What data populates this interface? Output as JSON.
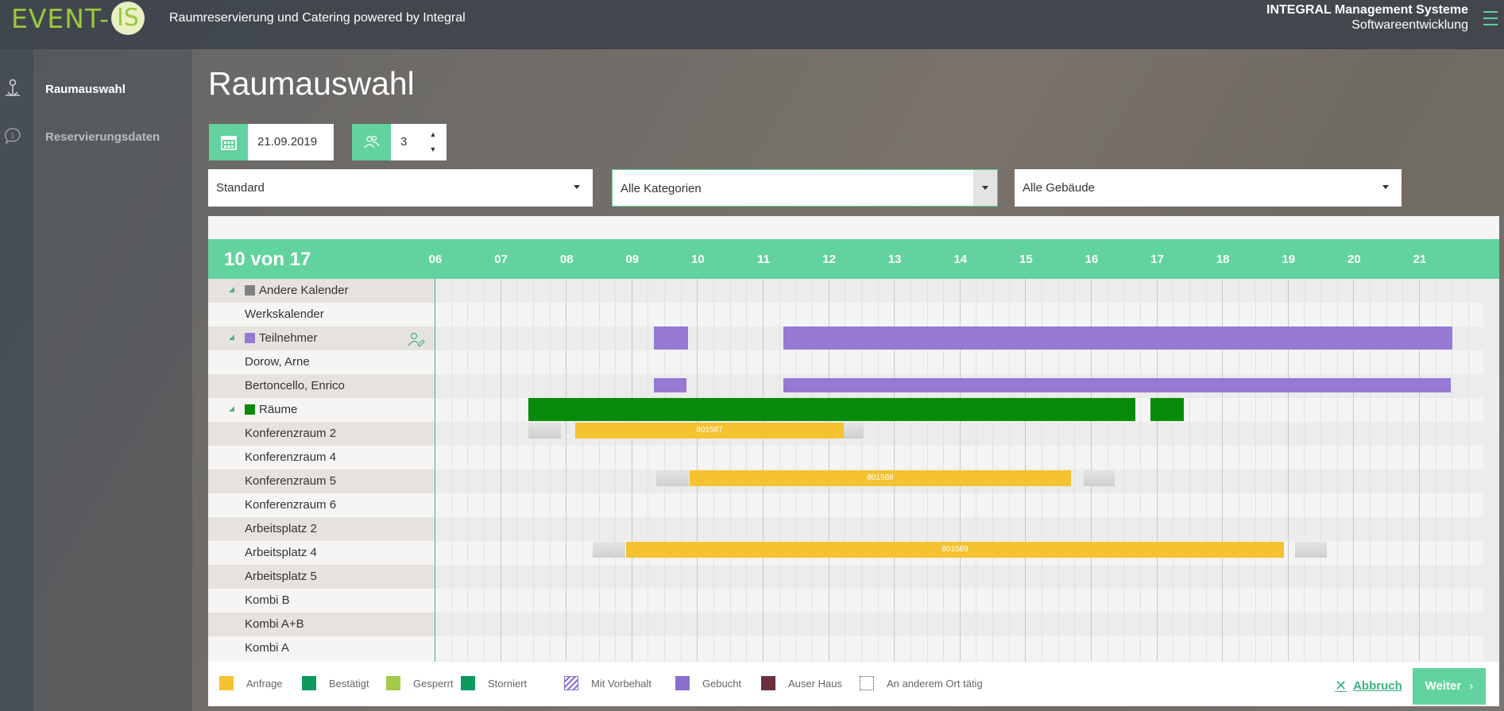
{
  "header": {
    "logo_text": "EVENT-",
    "logo_mark": "IS",
    "subtitle": "Raumreservierung und Catering powered by Integral",
    "company_line1": "INTEGRAL Management Systeme",
    "company_line2": "Softwareentwicklung"
  },
  "nav": {
    "items": [
      {
        "label": "Raumauswahl",
        "icon": "anchor-person-icon",
        "active": true
      },
      {
        "label": "Reservierungsdaten",
        "icon": "info-bubble-icon",
        "active": false
      }
    ]
  },
  "page": {
    "title": "Raumauswahl",
    "date_value": "21.09.2019",
    "persons_value": "3",
    "select_layout": "Standard",
    "select_category": "Alle Kategorien",
    "select_building": "Alle Gebäude"
  },
  "timeline": {
    "count_label": "10 von 17",
    "hours": [
      "06",
      "07",
      "08",
      "09",
      "10",
      "11",
      "12",
      "13",
      "14",
      "15",
      "16",
      "17",
      "18",
      "19",
      "20",
      "21"
    ],
    "rows": [
      {
        "label": "Andere Kalender",
        "group": true,
        "swatch": "#808080",
        "icon": ""
      },
      {
        "label": "Werkskalender",
        "group": false
      },
      {
        "label": "Teilnehmer",
        "group": true,
        "swatch": "#9579d3",
        "icon": "edit-person-icon"
      },
      {
        "label": "Dorow, Arne",
        "group": false
      },
      {
        "label": "Bertoncello, Enrico",
        "group": false
      },
      {
        "label": "Räume",
        "group": true,
        "swatch": "#0a8a0a"
      },
      {
        "label": "Konferenzraum 2",
        "group": false
      },
      {
        "label": "Konferenzraum 4",
        "group": false
      },
      {
        "label": "Konferenzraum 5",
        "group": false
      },
      {
        "label": "Konferenzraum 6",
        "group": false
      },
      {
        "label": "Arbeitsplatz 2",
        "group": false
      },
      {
        "label": "Arbeitsplatz 4",
        "group": false
      },
      {
        "label": "Arbeitsplatz 5",
        "group": false
      },
      {
        "label": "Kombi B",
        "group": false
      },
      {
        "label": "Kombi A+B",
        "group": false
      },
      {
        "label": "Kombi A",
        "group": false
      }
    ],
    "bookings": [
      {
        "row": 2,
        "kind": "purple",
        "label": ""
      },
      {
        "row": 2,
        "kind": "purple",
        "label": ""
      },
      {
        "row": 4,
        "kind": "purple-thin",
        "label": ""
      },
      {
        "row": 4,
        "kind": "purple-thin",
        "label": ""
      },
      {
        "row": 5,
        "kind": "green",
        "label": ""
      },
      {
        "row": 5,
        "kind": "green",
        "label": ""
      },
      {
        "row": 6,
        "kind": "yellow",
        "label": "801587"
      },
      {
        "row": 8,
        "kind": "yellow",
        "label": "801588"
      },
      {
        "row": 11,
        "kind": "yellow",
        "label": "801589"
      }
    ]
  },
  "legend": [
    {
      "label": "Anfrage",
      "color": "#f5c230",
      "style": "solid"
    },
    {
      "label": "Bestätigt",
      "color": "#0e9961",
      "style": "solid"
    },
    {
      "label": "Gesperrt",
      "color": "#a3c94a",
      "style": "solid"
    },
    {
      "label": "Storniert",
      "color": "#0e9961",
      "style": "solid"
    },
    {
      "label": "Mit Vorbehalt",
      "color": "#8a6fcf",
      "style": "hatched"
    },
    {
      "label": "Gebucht",
      "color": "#8a6fcf",
      "style": "solid"
    },
    {
      "label": "Auser Haus",
      "color": "#6b2f3e",
      "style": "solid"
    },
    {
      "label": "An anderem Ort tätig",
      "color": "#444444",
      "style": "dotted"
    }
  ],
  "actions": {
    "cancel_label": "Abbruch",
    "next_label": "Weiter"
  }
}
